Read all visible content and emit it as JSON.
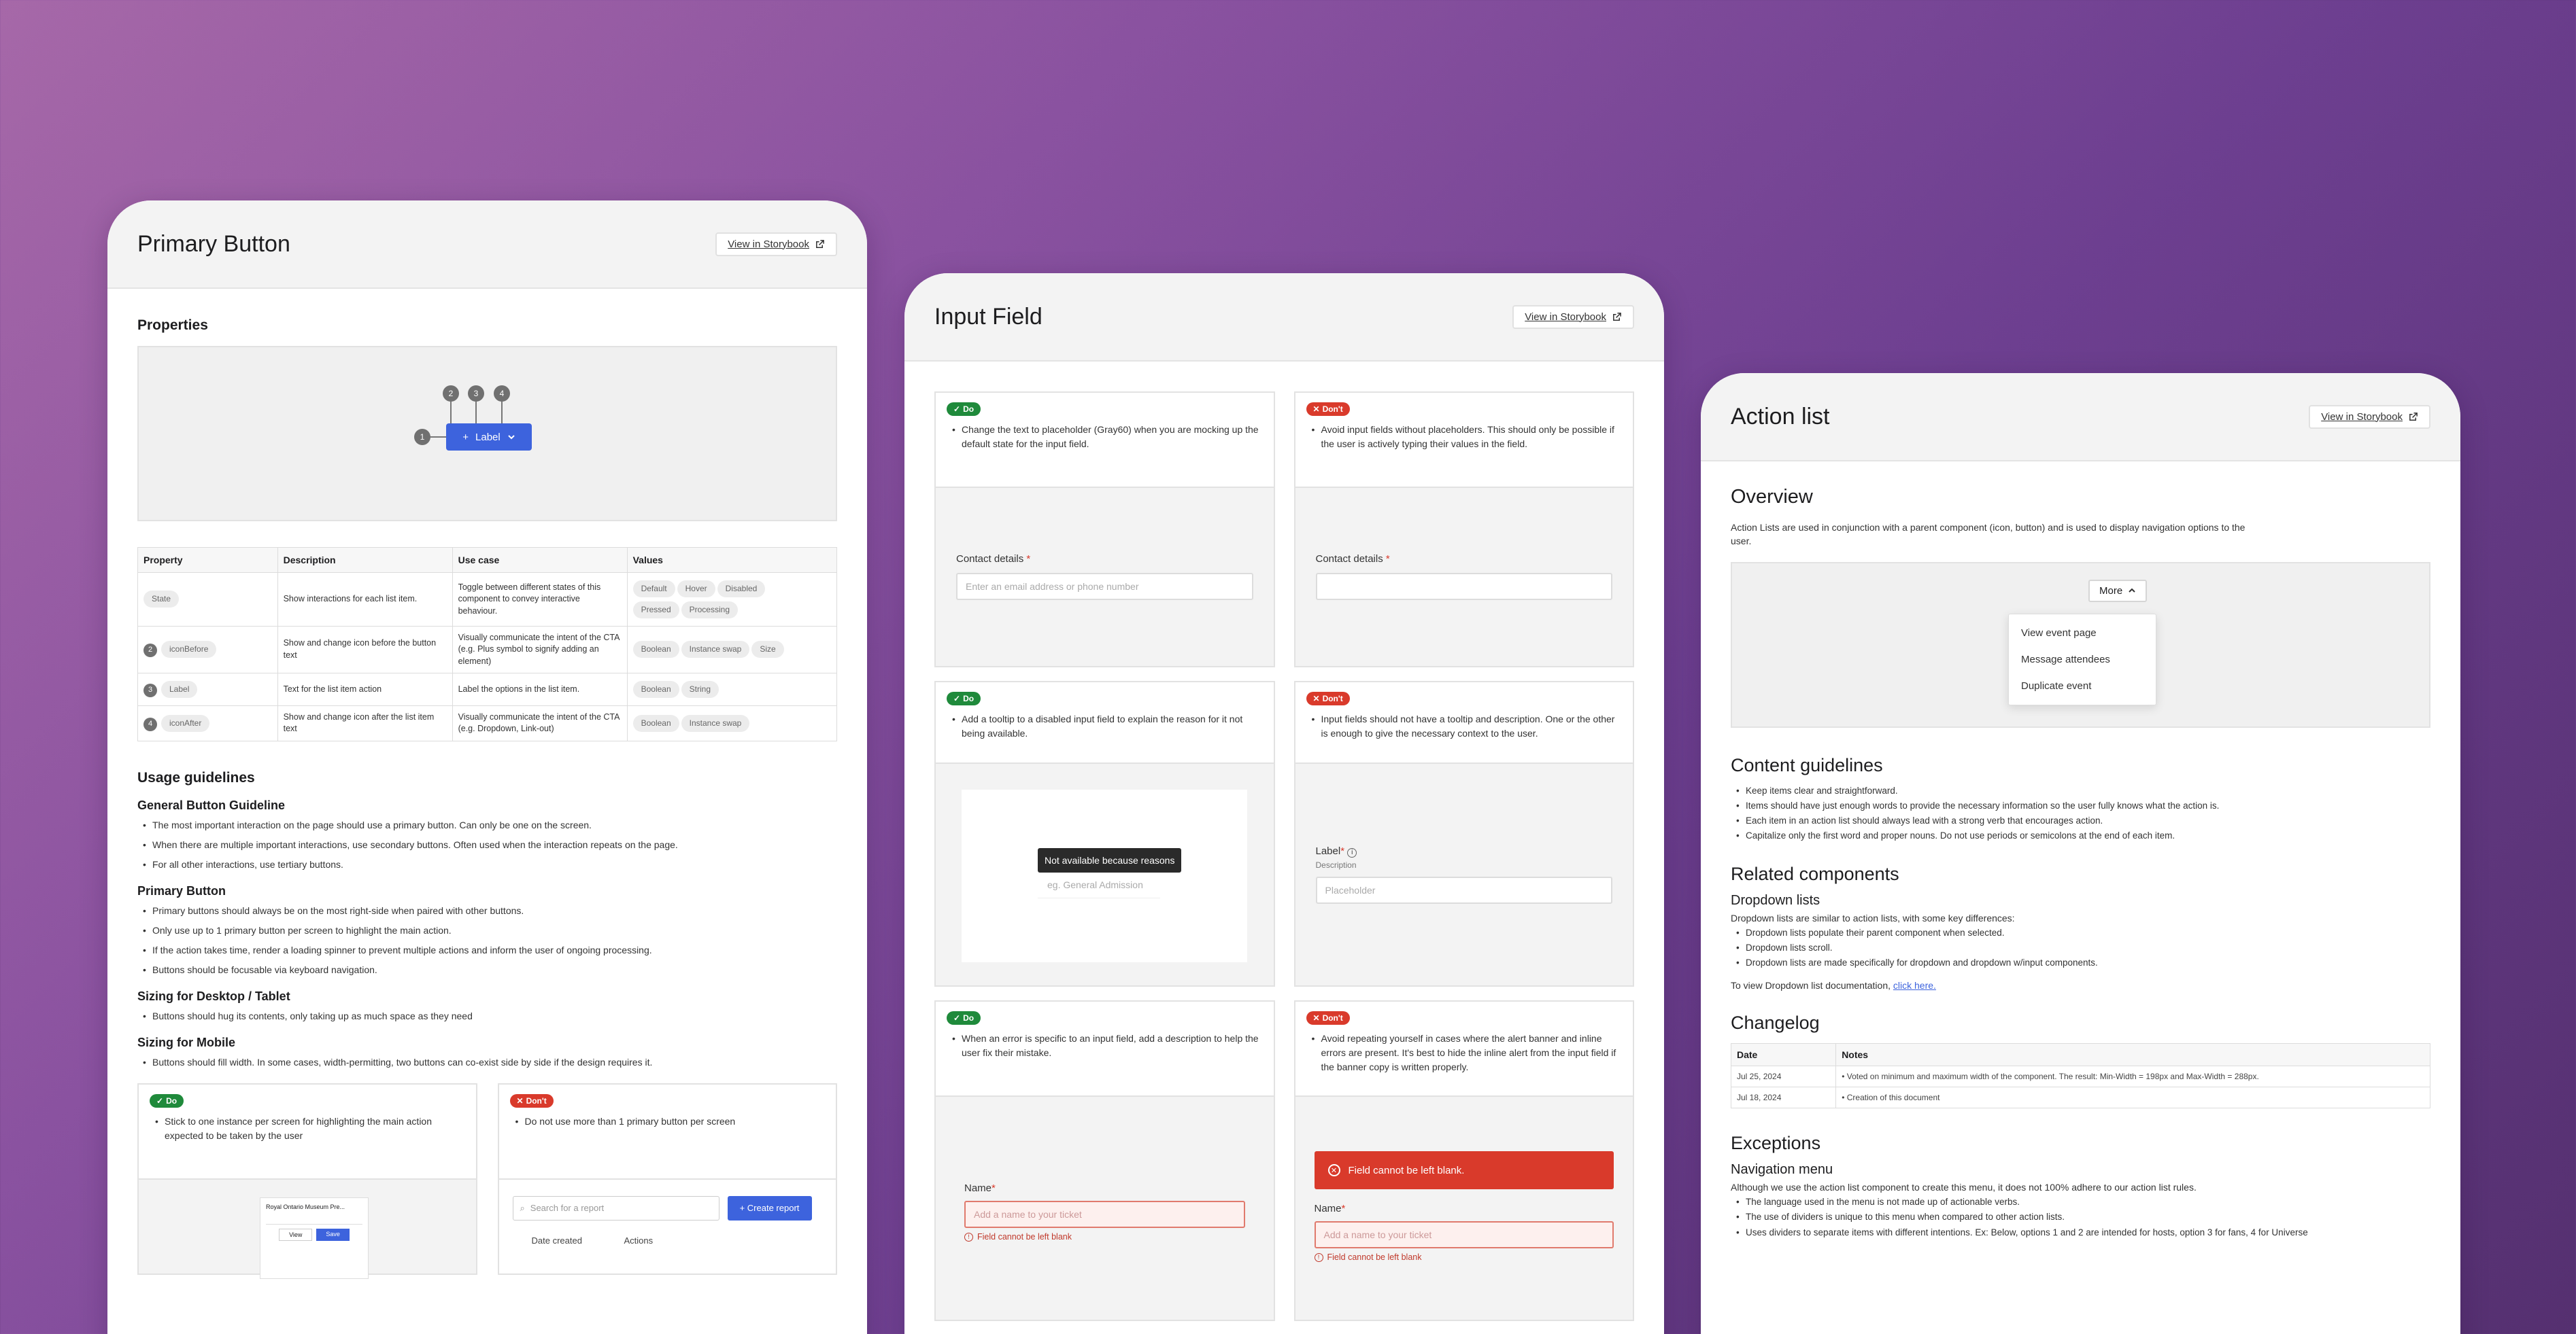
{
  "colors": {
    "primary": "#3d63dd",
    "do": "#1f8a3b",
    "dont": "#d93a2b",
    "error": "#d93a2b"
  },
  "storybook_label": "View in Storybook",
  "primary_button": {
    "title": "Primary Button",
    "properties_heading": "Properties",
    "preview_button_label": "Label",
    "pins": [
      "1",
      "2",
      "3",
      "4"
    ],
    "table": {
      "headers": [
        "Property",
        "Description",
        "Use case",
        "Values"
      ],
      "rows": [
        {
          "num": "",
          "prop": "State",
          "desc": "Show interactions for each list item.",
          "use": "Toggle between different states of this component to convey interactive behaviour.",
          "values": [
            "Default",
            "Hover",
            "Disabled",
            "Pressed",
            "Processing"
          ]
        },
        {
          "num": "2",
          "prop": "iconBefore",
          "desc": "Show and change icon before the button text",
          "use": "Visually communicate the intent of the CTA (e.g. Plus symbol to signify adding an element)",
          "values": [
            "Boolean",
            "Instance swap",
            "Size"
          ]
        },
        {
          "num": "3",
          "prop": "Label",
          "desc": "Text for the list item action",
          "use": "Label the options in the list item.",
          "values": [
            "Boolean",
            "String"
          ]
        },
        {
          "num": "4",
          "prop": "iconAfter",
          "desc": "Show and change icon after the list item text",
          "use": "Visually communicate the intent of the CTA (e.g. Dropdown, Link-out)",
          "values": [
            "Boolean",
            "Instance swap"
          ]
        }
      ]
    },
    "usage_heading": "Usage guidelines",
    "sections": [
      {
        "title": "General Button Guideline",
        "items": [
          "The most important interaction on the page should use a primary button. Can only be one on the screen.",
          "When there are multiple important interactions, use secondary buttons. Often used when the interaction repeats on the page.",
          "For all other interactions, use tertiary buttons."
        ]
      },
      {
        "title": "Primary Button",
        "items": [
          "Primary buttons should always be on the most right-side when paired with other buttons.",
          "Only use up to 1 primary button per screen to highlight the main action.",
          "If the action takes time, render a loading spinner to prevent multiple actions and inform the user of ongoing processing.",
          "Buttons should be focusable via keyboard navigation."
        ]
      },
      {
        "title": "Sizing for Desktop / Tablet",
        "items": [
          "Buttons should hug its contents, only taking up as much space as they need"
        ]
      },
      {
        "title": "Sizing for Mobile",
        "items": [
          "Buttons should fill width. In some cases, width-permitting, two buttons can co-exist side by side if the design requires it."
        ]
      }
    ],
    "do": {
      "badge": "Do",
      "text": "Stick to one instance per screen for highlighting the main action expected to be taken by the user",
      "mock_title": "Royal Ontario Museum Pre...",
      "mock_view": "View",
      "mock_save": "Save"
    },
    "dont": {
      "badge": "Don't",
      "text": "Do not use more than 1 primary button per screen",
      "search_placeholder": "Search for a report",
      "create_label": "+ Create report",
      "col1": "Date created",
      "col2": "Actions"
    }
  },
  "input_field": {
    "title": "Input Field",
    "pairs": [
      {
        "do_text": "Change the text to placeholder (Gray60) when you are mocking up the default state for the input field.",
        "do_label": "Contact details",
        "do_placeholder": "Enter an email address or phone number",
        "dont_text": "Avoid input fields without placeholders. This should only be possible if the user is actively typing their values in the field.",
        "dont_label": "Contact details"
      },
      {
        "do_text": "Add a tooltip to a disabled input field to explain the reason for it not being available.",
        "tooltip": "Not available because reasons",
        "do_placeholder": "eg. General Admission",
        "dont_text": "Input fields should not have a tooltip and description. One or the other is enough to give the necessary context to the user.",
        "dont_label": "Label",
        "dont_desc": "Description",
        "dont_placeholder": "Placeholder"
      },
      {
        "do_text": "When an error is specific to an input field, add a description to help the user fix their mistake.",
        "do_label": "Name",
        "do_placeholder": "Add a name to your ticket",
        "do_error": "Field cannot be left blank",
        "dont_text": "Avoid repeating yourself in cases where the alert banner and inline errors are present. It's best to hide the inline alert from the input field if the banner copy is written properly.",
        "banner": "Field cannot be left blank.",
        "dont_label": "Name",
        "dont_placeholder": "Add a name to your ticket",
        "dont_error": "Field cannot be left blank"
      }
    ],
    "badge_do": "Do",
    "badge_dont": "Don't"
  },
  "action_list": {
    "title": "Action list",
    "overview_heading": "Overview",
    "overview_text": "Action Lists are used in conjunction with a parent component (icon, button) and is used to display navigation options to the user.",
    "menu_button": "More",
    "menu_items": [
      "View event page",
      "Message attendees",
      "Duplicate event"
    ],
    "content_heading": "Content guidelines",
    "content_items": [
      "Keep items clear and straightforward.",
      "Items should have just enough words to provide the necessary information so the user fully knows what the action is.",
      "Each item in an action list should always lead with a strong verb that encourages action.",
      "Capitalize only the first word and proper nouns. Do not use periods or semicolons at the end of each item."
    ],
    "related_heading": "Related components",
    "dropdown_heading": "Dropdown lists",
    "dropdown_intro": "Dropdown lists are similar to action lists, with some key differences:",
    "dropdown_items": [
      "Dropdown lists populate their parent component when selected.",
      "Dropdown lists scroll.",
      "Dropdown lists are made specifically for dropdown and dropdown w/input components."
    ],
    "dropdown_link_pre": "To view Dropdown list documentation,",
    "dropdown_link": "click here.",
    "changelog_heading": "Changelog",
    "changelog_headers": [
      "Date",
      "Notes"
    ],
    "changelog_rows": [
      {
        "date": "Jul 25, 2024",
        "note": "Voted on minimum and maximum width of the component. The result: Min-Width = 198px and Max-Width = 288px."
      },
      {
        "date": "Jul 18, 2024",
        "note": "Creation of this document"
      }
    ],
    "exceptions_heading": "Exceptions",
    "nav_heading": "Navigation menu",
    "nav_intro": "Although we use the action list component to create this menu, it does not 100% adhere to our action list rules.",
    "nav_items": [
      "The language used in the menu is not made up of actionable verbs.",
      "The use of dividers is unique to this menu when compared to other action lists.",
      "Uses dividers to separate items with different intentions. Ex: Below, options 1 and 2 are intended for hosts, option 3 for fans, 4 for Universe"
    ]
  }
}
